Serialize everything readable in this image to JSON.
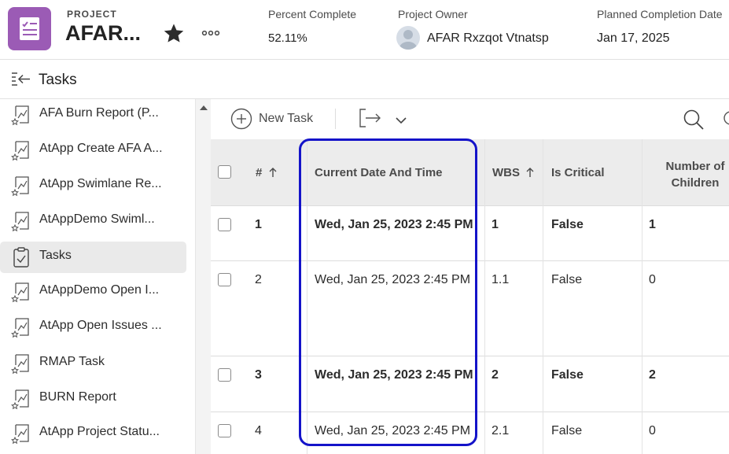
{
  "header": {
    "project_label": "PROJECT",
    "project_name": "AFAR...",
    "percent_complete_label": "Percent Complete",
    "percent_complete_value": "52.11%",
    "owner_label": "Project Owner",
    "owner_name": "AFAR Rxzqot Vtnatsp",
    "planned_label": "Planned Completion Date",
    "planned_value": "Jan 17, 2025"
  },
  "subheader": {
    "title": "Tasks"
  },
  "sidebar": {
    "items": [
      {
        "label": "AFA Burn Report (P...",
        "icon": "report-icon"
      },
      {
        "label": "AtApp Create AFA A...",
        "icon": "report-icon"
      },
      {
        "label": "AtApp Swimlane Re...",
        "icon": "report-icon"
      },
      {
        "label": "AtAppDemo Swiml...",
        "icon": "report-icon"
      },
      {
        "label": "Tasks",
        "icon": "clipboard-check-icon",
        "active": true
      },
      {
        "label": "AtAppDemo Open I...",
        "icon": "report-icon"
      },
      {
        "label": "AtApp Open Issues ...",
        "icon": "report-icon"
      },
      {
        "label": "RMAP Task",
        "icon": "report-icon"
      },
      {
        "label": "BURN Report",
        "icon": "report-icon"
      },
      {
        "label": "AtApp Project Statu...",
        "icon": "report-icon"
      }
    ]
  },
  "toolbar": {
    "new_task_label": "New Task"
  },
  "table": {
    "columns": [
      {
        "label": "#",
        "sort": "asc"
      },
      {
        "label": "Current Date And Time"
      },
      {
        "label": "WBS",
        "sort": "asc"
      },
      {
        "label": "Is Critical"
      },
      {
        "label": "Number of Children"
      }
    ],
    "rows": [
      {
        "num": "1",
        "datetime": "Wed, Jan 25, 2023 2:45 PM",
        "wbs": "1",
        "critical": "False",
        "children": "1",
        "bold": true
      },
      {
        "num": "2",
        "datetime": "Wed, Jan 25, 2023 2:45 PM",
        "wbs": "1.1",
        "critical": "False",
        "children": "0",
        "bold": false
      },
      {
        "num": "3",
        "datetime": "Wed, Jan 25, 2023 2:45 PM",
        "wbs": "2",
        "critical": "False",
        "children": "2",
        "bold": true
      },
      {
        "num": "4",
        "datetime": "Wed, Jan 25, 2023 2:45 PM",
        "wbs": "2.1",
        "critical": "False",
        "children": "0",
        "bold": false
      }
    ]
  },
  "colors": {
    "accent": "#9b5bb5",
    "highlight": "#1413c9",
    "header_bg": "#ececec"
  }
}
